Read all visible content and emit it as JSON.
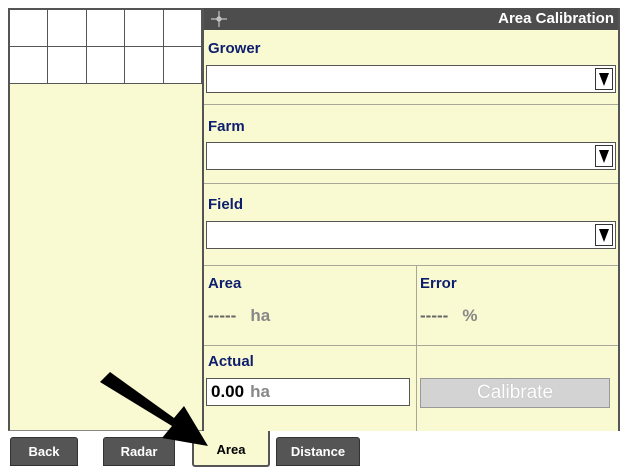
{
  "window": {
    "title": "Area Calibration",
    "compass_icon": "crosshair-compass-icon"
  },
  "form": {
    "grower": {
      "label": "Grower",
      "value": ""
    },
    "farm": {
      "label": "Farm",
      "value": ""
    },
    "field": {
      "label": "Field",
      "value": ""
    },
    "area": {
      "label": "Area",
      "value": "-----",
      "unit": "ha"
    },
    "error": {
      "label": "Error",
      "value": "-----",
      "unit": "%"
    },
    "actual": {
      "label": "Actual",
      "value": "0.00",
      "unit": "ha"
    },
    "calibrate_label": "Calibrate"
  },
  "tabs": [
    {
      "label": "Back",
      "active": false
    },
    {
      "label": "Radar",
      "active": false
    },
    {
      "label": "Area",
      "active": true
    },
    {
      "label": "Distance",
      "active": false
    }
  ],
  "colors": {
    "panel": "#fafad2",
    "title_bar": "#4d4d4d",
    "label_text": "#0e1e6e",
    "tab": "#555555"
  }
}
